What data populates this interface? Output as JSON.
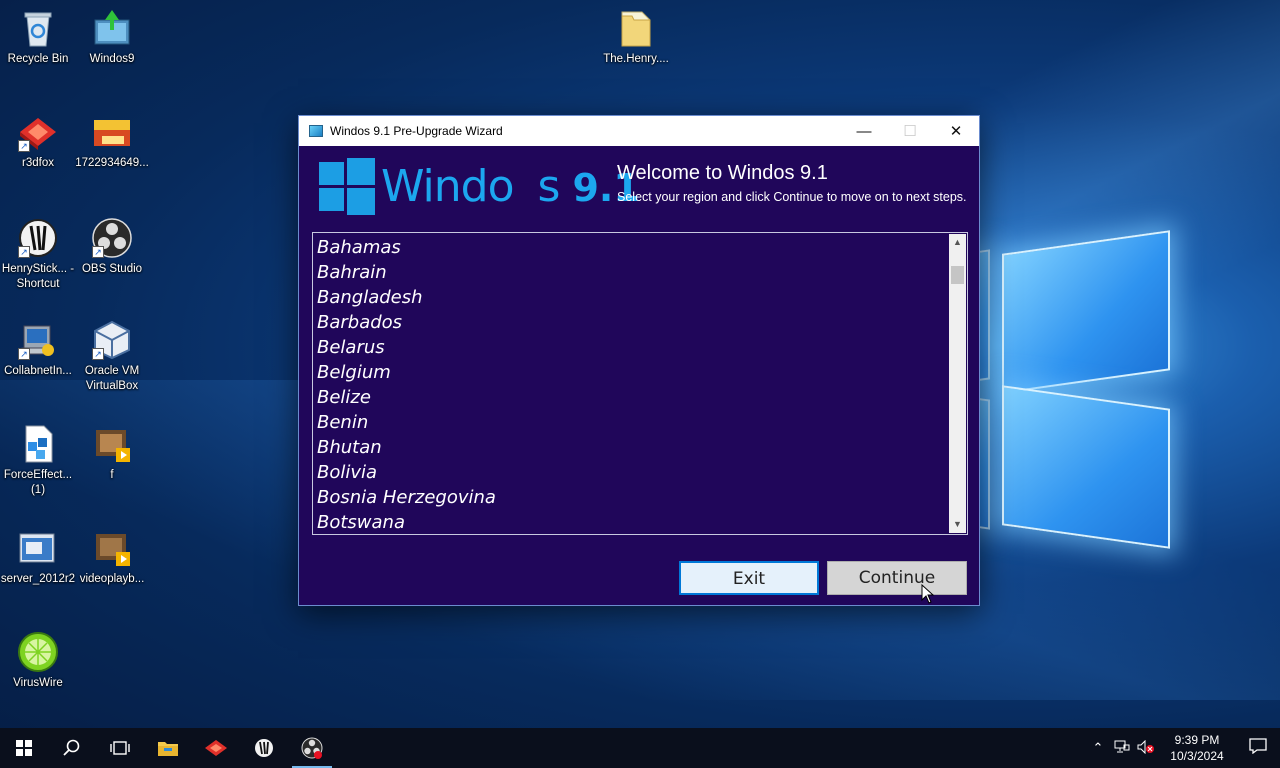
{
  "desktop": {
    "icons": [
      {
        "label": "Recycle Bin",
        "icon": "recycle-bin-icon"
      },
      {
        "label": "Windos9",
        "icon": "installer-icon"
      },
      {
        "label": "The.Henry....",
        "icon": "folder-icon"
      },
      {
        "label": "r3dfox",
        "icon": "r3dfox-icon"
      },
      {
        "label": "1722934649...",
        "icon": "image-icon"
      },
      {
        "label": "HenryStick... - Shortcut",
        "icon": "henrystick-icon"
      },
      {
        "label": "OBS Studio",
        "icon": "obs-icon"
      },
      {
        "label": "CollabnetIn...",
        "icon": "installer-icon"
      },
      {
        "label": "Oracle VM VirtualBox",
        "icon": "virtualbox-icon"
      },
      {
        "label": "ForceEffect... (1)",
        "icon": "document-icon"
      },
      {
        "label": "f",
        "icon": "video-icon"
      },
      {
        "label": "server_2012r2",
        "icon": "window-image-icon"
      },
      {
        "label": "videoplayb...",
        "icon": "video-icon"
      },
      {
        "label": "VirusWire",
        "icon": "lime-icon"
      }
    ]
  },
  "wizard": {
    "title": "Windos 9.1 Pre-Upgrade Wizard",
    "brand_left": "Windo",
    "brand_right": "s",
    "brand_version": "9.1",
    "welcome_title": "Welcome to Windos 9.1",
    "welcome_sub": "Select your region and click Continue to move on to next steps.",
    "regions": [
      "Bahamas",
      "Bahrain",
      "Bangladesh",
      "Barbados",
      "Belarus",
      "Belgium",
      "Belize",
      "Benin",
      "Bhutan",
      "Bolivia",
      "Bosnia Herzegovina",
      "Botswana"
    ],
    "exit_label": "Exit",
    "continue_label": "Continue",
    "colors": {
      "accent": "#1ca7ef",
      "background": "#20065a"
    }
  },
  "taskbar": {
    "time": "9:39 PM",
    "date": "10/3/2024"
  }
}
